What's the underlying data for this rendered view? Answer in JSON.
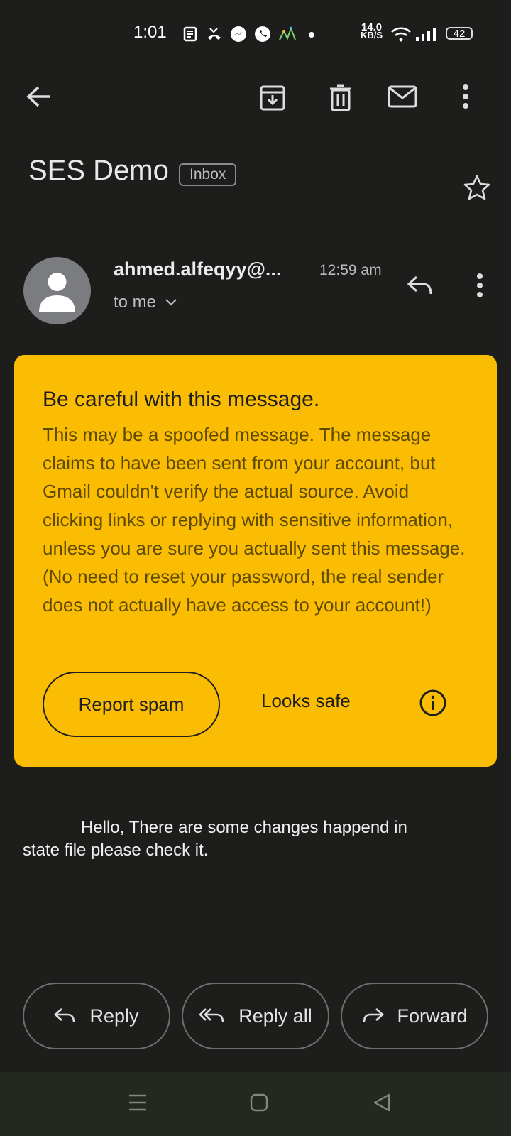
{
  "status_bar": {
    "time": "1:01",
    "net_speed_value": "14.0",
    "net_speed_unit": "KB/S",
    "battery": "42"
  },
  "toolbar": {
    "icons": [
      "back-arrow-icon",
      "archive-icon",
      "delete-icon",
      "mark-unread-icon",
      "more-vert-icon"
    ]
  },
  "email": {
    "subject": "SES Demo",
    "label": "Inbox",
    "sender": "ahmed.alfeqyy@...",
    "time": "12:59 am",
    "recipient": "to me",
    "body_line1": "Hello, There are some changes happend in",
    "body_line2": "state file please check it."
  },
  "warning": {
    "title": "Be careful with this message.",
    "body": "This may be a spoofed message. The message claims to have been sent from your account, but Gmail couldn't verify the actual source. Avoid clicking links or replying with sensitive information, unless you are sure you actually sent this message. (No need to reset your password, the real sender does not actually have access to your account!)",
    "report_spam": "Report spam",
    "looks_safe": "Looks safe",
    "color": "#fbbc04"
  },
  "actions": {
    "reply": "Reply",
    "reply_all": "Reply all",
    "forward": "Forward"
  },
  "theme": {
    "background": "#1d1d1b",
    "nav_bar": "#232821"
  }
}
